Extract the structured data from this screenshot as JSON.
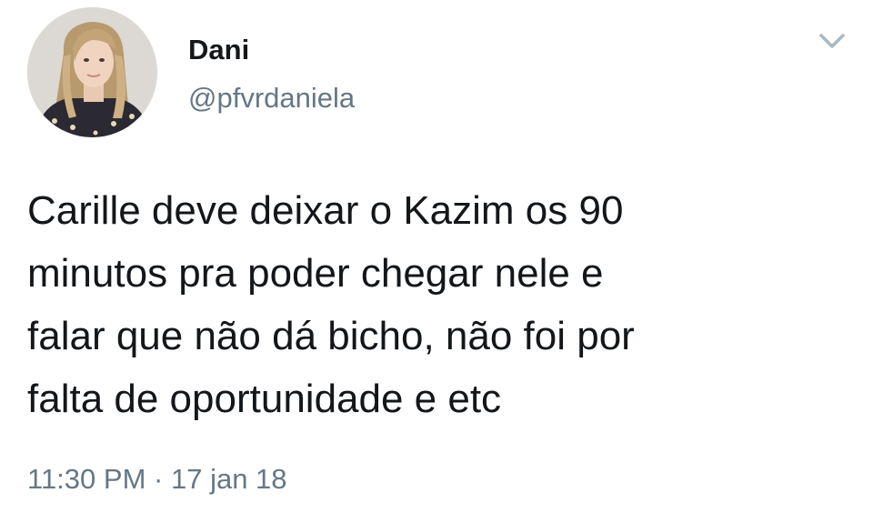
{
  "author": {
    "display_name": "Dani",
    "handle": "@pfvrdaniela",
    "avatar_icon": "profile-photo"
  },
  "tweet": {
    "lines": [
      "Carille deve deixar o Kazim os 90",
      "minutos pra poder chegar nele e",
      "falar que não dá bicho, não foi por",
      "falta de oportunidade e etc"
    ],
    "time": "11:30 PM",
    "separator": "·",
    "date": "17 jan 18"
  },
  "menu": {
    "icon": "chevron-down-icon"
  },
  "colors": {
    "text_primary": "#14171a",
    "text_secondary": "#657786",
    "chevron": "#aab8c2",
    "background": "#ffffff"
  }
}
